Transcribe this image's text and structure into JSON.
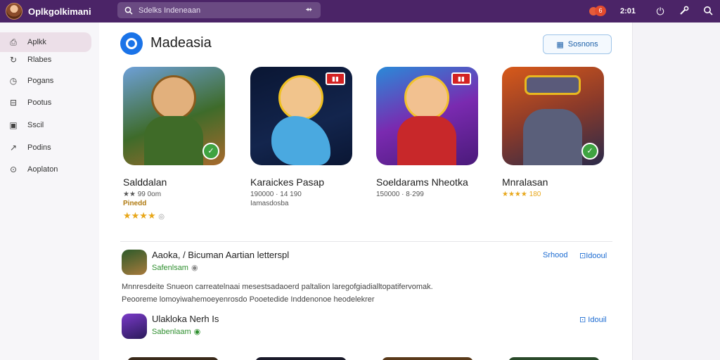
{
  "topbar": {
    "app_name": "Oplkgolkimani",
    "search_placeholder": "Sdelks Indeneaan",
    "notification_count": "6",
    "clock": "2:01"
  },
  "sidebar": {
    "items": [
      {
        "label": "Aplkk",
        "icon": "app-icon",
        "active": true
      },
      {
        "label": "Rlabes",
        "icon": "refresh-icon",
        "active": false
      },
      {
        "label": "Pogans",
        "icon": "clock-icon",
        "active": false
      },
      {
        "label": "Pootus",
        "icon": "minus-box-icon",
        "active": false
      },
      {
        "label": "Sscil",
        "icon": "document-icon",
        "active": false
      },
      {
        "label": "Podins",
        "icon": "trend-icon",
        "active": false
      },
      {
        "label": "Aoplaton",
        "icon": "info-icon",
        "active": false
      }
    ]
  },
  "main": {
    "section_title": "Madeasia",
    "sections_button": "Sosnons",
    "cards": [
      {
        "title": "Salddalan",
        "meta": "★★ 99 0om",
        "sub": "Pinedd",
        "stars": "★★★★",
        "rating_icon": "info-icon",
        "colors": [
          "#3e6b2a",
          "#c88b3c"
        ]
      },
      {
        "title": "Karaickes Pasap",
        "meta": "190000 · 14 190",
        "sub": "Iamasdosba",
        "stars": "",
        "rating_icon": "",
        "colors": [
          "#0d1b3a",
          "#e24a4a"
        ]
      },
      {
        "title": "Soeldarams Nheotka",
        "meta": "150000 · 8·299",
        "sub": "",
        "stars": "",
        "rating_icon": "",
        "colors": [
          "#5a2a8a",
          "#d43a2a"
        ]
      },
      {
        "title": "Mnralasan",
        "meta": "★★★★ 180",
        "sub": "",
        "stars": "",
        "rating_icon": "",
        "colors": [
          "#8a3a1a",
          "#3a3a5a"
        ]
      }
    ],
    "list": [
      {
        "title": "Aaoka, / Bicuman Aartian letterspl",
        "subtitle": "Safenlsam",
        "action1": "Srhood",
        "action2": "Idooul"
      },
      {
        "title": "Ulakloka Nerh Is",
        "subtitle": "Sabenlaam",
        "action1": "",
        "action2": "Idouil"
      }
    ],
    "descriptions": [
      "Mnnresdeite Snueon carreatelnaai mesestsadaoerd paltalion laregofgiadialltopatifervomak.",
      "Peooreme lomoyiwahemoeyenrosdo Pooetedide Inddenonoe heodelekrer"
    ]
  },
  "colors": {
    "topbar": "#4b2467",
    "accent": "#1a73e8",
    "sidebar_active": "#ecdfe8"
  }
}
